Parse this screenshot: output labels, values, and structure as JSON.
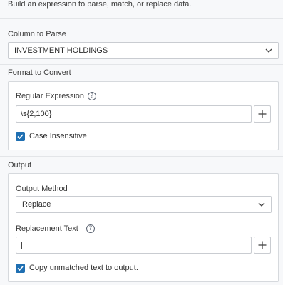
{
  "description": "Build an expression to parse, match, or replace data.",
  "column_to_parse": {
    "label": "Column to Parse",
    "selected": "INVESTMENT HOLDINGS",
    "chevron_icon": "chevron-down-icon"
  },
  "format_to_convert": {
    "label": "Format to Convert",
    "regex_label": "Regular Expression",
    "help_icon": "?",
    "regex_value": "\\s{2,100}",
    "add_icon": "plus-icon",
    "case_insensitive": {
      "label": "Case Insensitive",
      "checked": true
    }
  },
  "output": {
    "label": "Output",
    "method_label": "Output Method",
    "method_selected": "Replace",
    "replacement_label": "Replacement Text",
    "help_icon": "?",
    "replacement_value": "|",
    "add_icon": "plus-icon",
    "copy_unmatched": {
      "label": "Copy unmatched text to output.",
      "checked": true
    }
  },
  "colors": {
    "accent": "#1f6fb2",
    "border": "#c9ccd1",
    "background": "#f7f8fa"
  }
}
